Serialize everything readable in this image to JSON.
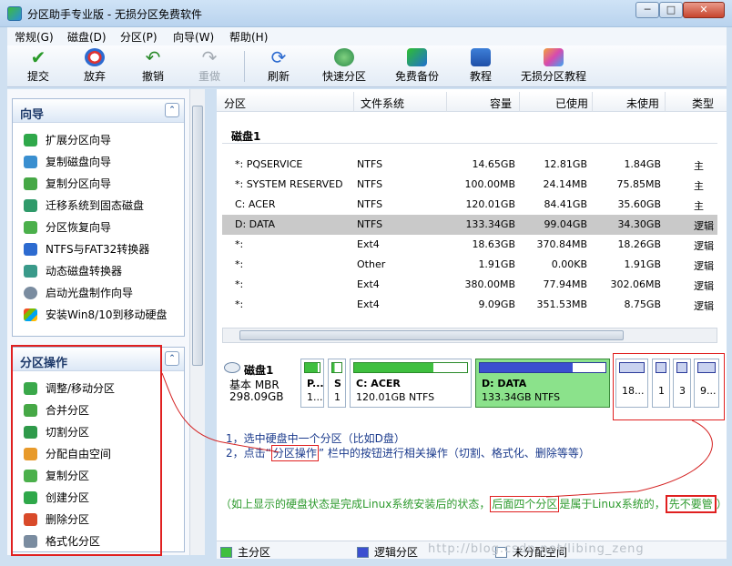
{
  "window": {
    "title": "分区助手专业版 - 无损分区免费软件",
    "controls": {
      "minimize": "─",
      "maximize": "□",
      "close": "✕"
    }
  },
  "menu": [
    "常规(G)",
    "磁盘(D)",
    "分区(P)",
    "向导(W)",
    "帮助(H)"
  ],
  "toolbar": {
    "commit": "提交",
    "discard": "放弃",
    "undo": "撤销",
    "redo": "重做",
    "refresh": "刷新",
    "quick_partition": "快速分区",
    "free_backup": "免费备份",
    "tutorial": "教程",
    "lossless_tutorial": "无损分区教程"
  },
  "wizard_group": {
    "title": "向导",
    "collapse": "⌃",
    "items": [
      "扩展分区向导",
      "复制磁盘向导",
      "复制分区向导",
      "迁移系统到固态磁盘",
      "分区恢复向导",
      "NTFS与FAT32转换器",
      "动态磁盘转换器",
      "启动光盘制作向导",
      "安装Win8/10到移动硬盘"
    ]
  },
  "partition_ops_group": {
    "title": "分区操作",
    "collapse": "⌃",
    "items": [
      "调整/移动分区",
      "合并分区",
      "切割分区",
      "分配自由空间",
      "复制分区",
      "创建分区",
      "删除分区",
      "格式化分区"
    ]
  },
  "table": {
    "headers": [
      "分区",
      "文件系统",
      "容量",
      "已使用",
      "未使用",
      "类型"
    ],
    "disk_heading": "磁盘1",
    "rows": [
      {
        "name": "*: PQSERVICE",
        "fs": "NTFS",
        "capacity": "14.65GB",
        "used": "12.81GB",
        "unused": "1.84GB",
        "type": "主"
      },
      {
        "name": "*: SYSTEM RESERVED",
        "fs": "NTFS",
        "capacity": "100.00MB",
        "used": "24.14MB",
        "unused": "75.85MB",
        "type": "主"
      },
      {
        "name": "C: ACER",
        "fs": "NTFS",
        "capacity": "120.01GB",
        "used": "84.41GB",
        "unused": "35.60GB",
        "type": "主"
      },
      {
        "name": "D: DATA",
        "fs": "NTFS",
        "capacity": "133.34GB",
        "used": "99.04GB",
        "unused": "34.30GB",
        "type": "逻辑"
      },
      {
        "name": "*:",
        "fs": "Ext4",
        "capacity": "18.63GB",
        "used": "370.84MB",
        "unused": "18.26GB",
        "type": "逻辑"
      },
      {
        "name": "*:",
        "fs": "Other",
        "capacity": "1.91GB",
        "used": "0.00KB",
        "unused": "1.91GB",
        "type": "逻辑"
      },
      {
        "name": "*:",
        "fs": "Ext4",
        "capacity": "380.00MB",
        "used": "77.94MB",
        "unused": "302.06MB",
        "type": "逻辑"
      },
      {
        "name": "*:",
        "fs": "Ext4",
        "capacity": "9.09GB",
        "used": "351.53MB",
        "unused": "8.75GB",
        "type": "逻辑"
      }
    ]
  },
  "diskmap": {
    "disk_label": "磁盘1",
    "disk_type": "基本 MBR",
    "disk_size": "298.09GB",
    "parts": [
      {
        "t1": "P...",
        "t2": "1..."
      },
      {
        "t1": "S",
        "t2": "1"
      },
      {
        "t1": "C: ACER",
        "t2": "120.01GB NTFS"
      },
      {
        "t1": "D: DATA",
        "t2": "133.34GB NTFS"
      },
      {
        "t1": "",
        "t2": "18..."
      },
      {
        "t1": "",
        "t2": "1"
      },
      {
        "t1": "",
        "t2": "3"
      },
      {
        "t1": "",
        "t2": "9..."
      }
    ]
  },
  "annotations": {
    "step1": "1，选中硬盘中一个分区（比如D盘）",
    "step2_a": "2，点击“",
    "step2_b": "分区操作",
    "step2_c": "” 栏中的按钮进行相关操作（切割、格式化、删除等等）",
    "note_a": "（如上显示的硬盘状态是完成Linux系统安装后的状态，",
    "note_b": "后面四个分区",
    "note_c": "是属于Linux系统的，",
    "note_d": "先不要管",
    "note_e": "）"
  },
  "legend": {
    "primary": "主分区",
    "logical": "逻辑分区",
    "unallocated": "未分配空间"
  },
  "watermark": "http://blog.csdn.net/libing_zeng",
  "colors": {
    "primary": "#3fbf3f",
    "logical": "#3b4fd0",
    "unallocated": "#ffffff",
    "selected_row": "#c9c9c9",
    "annotation_red": "#e02020"
  }
}
